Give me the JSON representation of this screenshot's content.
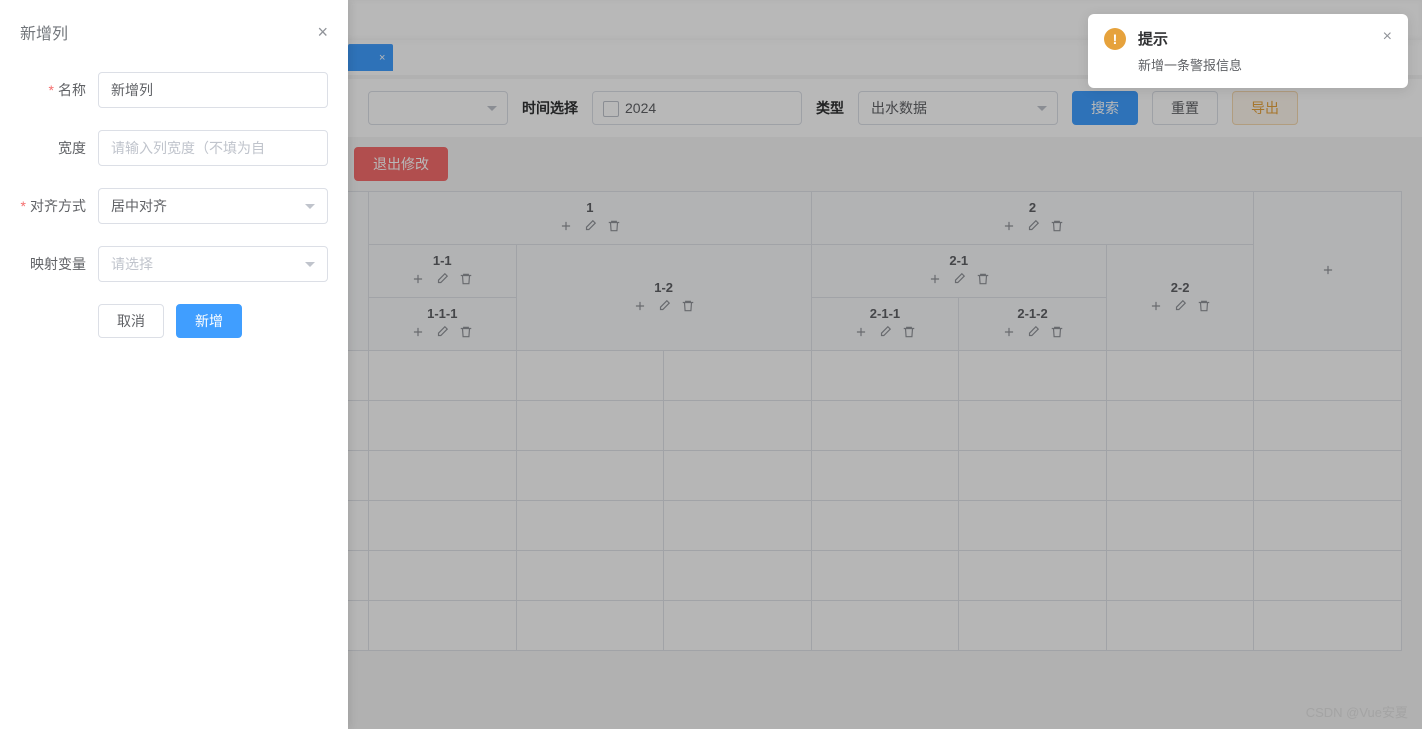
{
  "drawer": {
    "title": "新增列",
    "fields": {
      "name": {
        "label": "名称",
        "value": "新增列",
        "required": true
      },
      "width": {
        "label": "宽度",
        "placeholder": "请输入列宽度（不填为自",
        "required": false
      },
      "align": {
        "label": "对齐方式",
        "value": "居中对齐",
        "required": true
      },
      "mapvar": {
        "label": "映射变量",
        "placeholder": "请选择",
        "required": false
      }
    },
    "actions": {
      "cancel": "取消",
      "confirm": "新增"
    }
  },
  "tab": {
    "close_glyph": "×"
  },
  "filters": {
    "time_label": "时间选择",
    "time_value": "2024",
    "type_label": "类型",
    "type_value": "出水数据",
    "search": "搜索",
    "reset": "重置",
    "export": "导出"
  },
  "editbar": {
    "exit_edit": "退出修改"
  },
  "table": {
    "headers": {
      "r1": [
        "1",
        "2"
      ],
      "r2": [
        "1-1",
        "1-2",
        "2-1",
        "2-2"
      ],
      "r3": [
        "1-1-1",
        "2-1-1",
        "2-1-2"
      ]
    }
  },
  "toast": {
    "icon": "!",
    "title": "提示",
    "message": "新增一条警报信息"
  },
  "watermark": "CSDN @Vue安夏"
}
